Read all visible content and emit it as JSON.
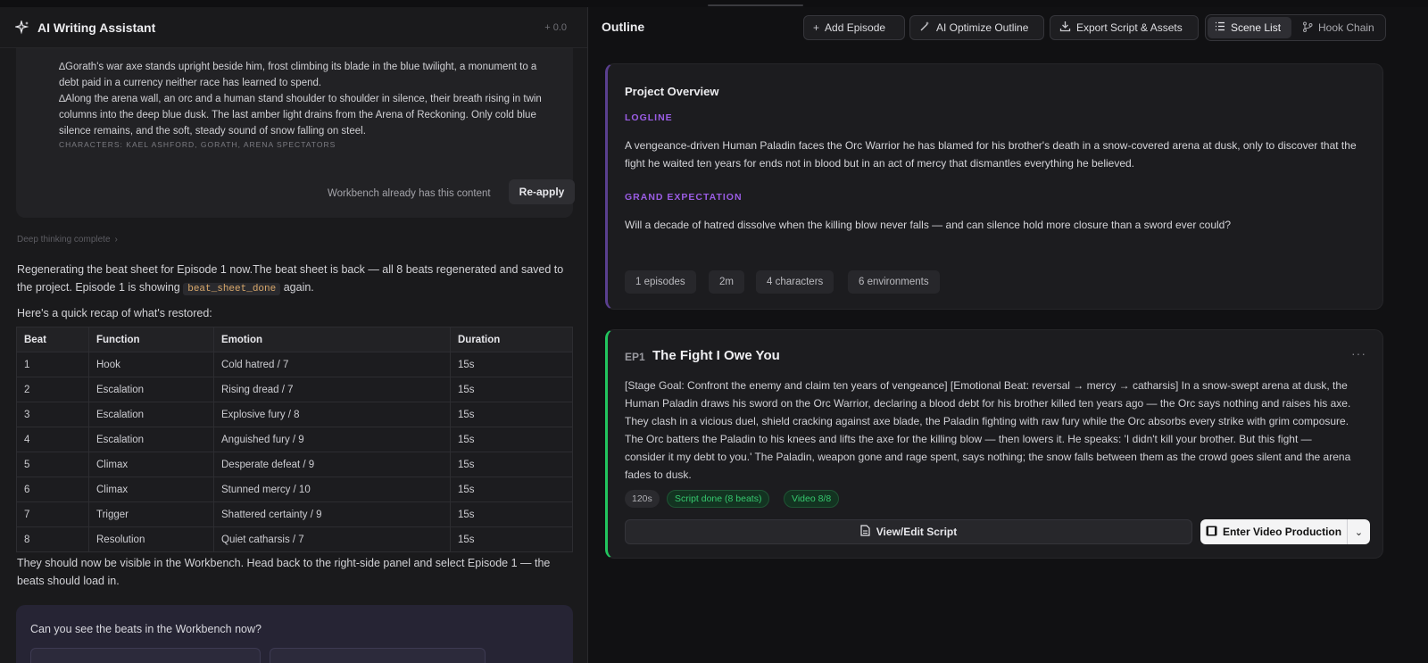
{
  "assistant": {
    "title": "AI Writing Assistant",
    "score": "+ 0.0",
    "card": {
      "para1": "∆Gorath's war axe stands upright beside him, frost climbing its blade in the blue twilight, a monument to a debt paid in a currency neither race has learned to spend.",
      "para2": "∆Along the arena wall, an orc and a human stand shoulder to shoulder in silence, their breath rising in twin columns into the deep blue dusk. The last amber light drains from the Arena of Reckoning. Only cold blue silence remains, and the soft, steady sound of snow falling on steel.",
      "characters": "CHARACTERS: KAEL ASHFORD, GORATH, ARENA SPECTATORS",
      "workbench_note": "Workbench already has this content",
      "reapply_label": "Re-apply"
    },
    "deep_thinking": "Deep thinking complete",
    "msg1_before": "Regenerating the beat sheet for Episode 1 now.The beat sheet is back — all 8 beats regenerated and saved to the project. Episode 1 is showing ",
    "msg1_code": "beat_sheet_done",
    "msg1_after": " again.",
    "msg2": "Here's a quick recap of what's restored:",
    "table": {
      "headers": [
        "Beat",
        "Function",
        "Emotion",
        "Duration"
      ],
      "rows": [
        [
          "1",
          "Hook",
          "Cold hatred / 7",
          "15s"
        ],
        [
          "2",
          "Escalation",
          "Rising dread / 7",
          "15s"
        ],
        [
          "3",
          "Escalation",
          "Explosive fury / 8",
          "15s"
        ],
        [
          "4",
          "Escalation",
          "Anguished fury / 9",
          "15s"
        ],
        [
          "5",
          "Climax",
          "Desperate defeat / 9",
          "15s"
        ],
        [
          "6",
          "Climax",
          "Stunned mercy / 10",
          "15s"
        ],
        [
          "7",
          "Trigger",
          "Shattered certainty / 9",
          "15s"
        ],
        [
          "8",
          "Resolution",
          "Quiet catharsis / 7",
          "15s"
        ]
      ]
    },
    "msg3": "They should now be visible in the Workbench. Head back to the right-side panel and select Episode 1 — the beats should load in.",
    "prompt_question": "Can you see the beats in the Workbench now?"
  },
  "outline": {
    "title": "Outline",
    "toolbar": {
      "add_episode": "Add Episode",
      "ai_optimize": "AI Optimize Outline",
      "export": "Export Script & Assets",
      "scene_list": "Scene List",
      "hook_chain": "Hook Chain"
    },
    "overview": {
      "heading": "Project Overview",
      "logline_label": "LOGLINE",
      "logline": "A vengeance-driven Human Paladin faces the Orc Warrior he has blamed for his brother's death in a snow-covered arena at dusk, only to discover that the fight he waited ten years for ends not in blood but in an act of mercy that dismantles everything he believed.",
      "expectation_label": "GRAND EXPECTATION",
      "expectation": "Will a decade of hatred dissolve when the killing blow never falls — and can silence hold more closure than a sword ever could?",
      "chips": [
        "1 episodes",
        "2m",
        "4 characters",
        "6 environments"
      ]
    },
    "episode": {
      "number": "EP1",
      "title": "The Fight I Owe You",
      "description": "[Stage Goal: Confront the enemy and claim ten years of vengeance] [Emotional Beat: reversal → mercy → catharsis] In a snow-swept arena at dusk, the Human Paladin draws his sword on the Orc Warrior, declaring a blood debt for his brother killed ten years ago — the Orc says nothing and raises his axe. They clash in a vicious duel, shield cracking against axe blade, the Paladin fighting with raw fury while the Orc absorbs every strike with grim composure. The Orc batters the Paladin to his knees and lifts the axe for the killing blow — then lowers it. He speaks: 'I didn't kill your brother. But this fight — consider it my debt to you.' The Paladin, weapon gone and rage spent, says nothing; the snow falls between them as the crowd goes silent and the arena fades to dusk.",
      "tags": [
        "120s",
        "Script done (8 beats)",
        "Video 8/8"
      ],
      "view_edit": "View/Edit Script",
      "enter_production": "Enter Video Production"
    }
  }
}
